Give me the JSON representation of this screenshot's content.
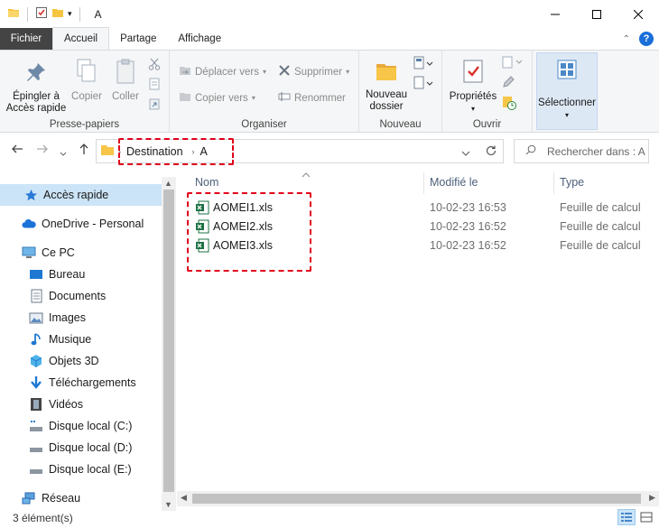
{
  "window": {
    "title": "A"
  },
  "tabs": {
    "file": "Fichier",
    "home": "Accueil",
    "share": "Partage",
    "view": "Affichage"
  },
  "ribbon": {
    "clipboard": {
      "label": "Presse-papiers",
      "pin": "Épingler à Accès rapide",
      "pin_line1": "Épingler à",
      "pin_line2": "Accès rapide",
      "copy": "Copier",
      "paste": "Coller"
    },
    "organize": {
      "label": "Organiser",
      "move_to": "Déplacer vers",
      "copy_to": "Copier vers",
      "delete": "Supprimer",
      "rename": "Renommer"
    },
    "new": {
      "label": "Nouveau",
      "new_folder_line1": "Nouveau",
      "new_folder_line2": "dossier"
    },
    "open": {
      "label": "Ouvrir",
      "properties": "Propriétés"
    },
    "select": {
      "label": "Sélectionner"
    }
  },
  "address": {
    "crumbs": [
      "Destination",
      "A"
    ],
    "search_placeholder": "Rechercher dans : A"
  },
  "nav_pane": {
    "quick_access": "Accès rapide",
    "onedrive": "OneDrive - Personal",
    "this_pc": "Ce PC",
    "desktop": "Bureau",
    "documents": "Documents",
    "images": "Images",
    "music": "Musique",
    "objects3d": "Objets 3D",
    "downloads": "Téléchargements",
    "videos": "Vidéos",
    "disk_c": "Disque local (C:)",
    "disk_d": "Disque local (D:)",
    "disk_e": "Disque local (E:)",
    "network": "Réseau"
  },
  "columns": {
    "name": "Nom",
    "modified": "Modifié le",
    "type": "Type"
  },
  "files": [
    {
      "name": "AOMEI1.xls",
      "modified": "10-02-23 16:53",
      "type": "Feuille de calcul"
    },
    {
      "name": "AOMEI2.xls",
      "modified": "10-02-23 16:52",
      "type": "Feuille de calcul"
    },
    {
      "name": "AOMEI3.xls",
      "modified": "10-02-23 16:52",
      "type": "Feuille de calcul"
    }
  ],
  "status": {
    "count": "3 élément(s)"
  },
  "colors": {
    "accent": "#1a6ed8",
    "selection": "#cce4f7",
    "annotation": "#e0001a",
    "folder": "#f5c542",
    "excel": "#1d7044"
  }
}
